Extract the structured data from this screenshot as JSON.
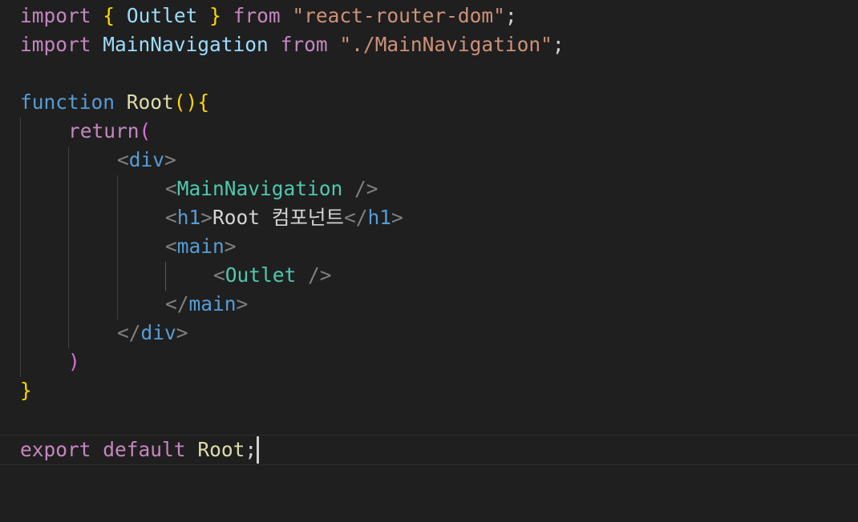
{
  "editor": {
    "line1": {
      "kw_import": "import",
      "brace_open": "{",
      "ident": "Outlet",
      "brace_close": "}",
      "kw_from": "from",
      "module": "\"react-router-dom\"",
      "semi": ";"
    },
    "line2": {
      "kw_import": "import",
      "ident": "MainNavigation",
      "kw_from": "from",
      "module": "\"./MainNavigation\"",
      "semi": ";"
    },
    "line4": {
      "kw_function": "function",
      "fn_name": "Root",
      "parens": "()",
      "brace_open": "{"
    },
    "line5": {
      "kw_return": "return",
      "paren_open": "("
    },
    "line6": {
      "lt": "<",
      "tag": "div",
      "gt": ">"
    },
    "line7": {
      "lt": "<",
      "component": "MainNavigation",
      "selfclose": " />"
    },
    "line8": {
      "lt": "<",
      "tag_open": "h1",
      "gt": ">",
      "text": "Root 컴포넌트",
      "lt_close": "</",
      "tag_close": "h1",
      "gt_close": ">"
    },
    "line9": {
      "lt": "<",
      "tag": "main",
      "gt": ">"
    },
    "line10": {
      "lt": "<",
      "component": "Outlet",
      "selfclose": " />"
    },
    "line11": {
      "lt": "</",
      "tag": "main",
      "gt": ">"
    },
    "line12": {
      "lt": "</",
      "tag": "div",
      "gt": ">"
    },
    "line13": {
      "paren_close": ")"
    },
    "line14": {
      "brace_close": "}"
    },
    "line16": {
      "kw_export": "export",
      "kw_default": "default",
      "ident": "Root",
      "semi": ";"
    }
  },
  "theme": {
    "background": "#1f1f1f",
    "keyword_control": "#c586c0",
    "keyword": "#569cd6",
    "identifier": "#9cdcfe",
    "function": "#dcdcaa",
    "string": "#ce9178",
    "bracket_level1": "#ffd700",
    "bracket_level2": "#da70d6",
    "component": "#4ec9b0",
    "tag_punctuation": "#808080"
  }
}
